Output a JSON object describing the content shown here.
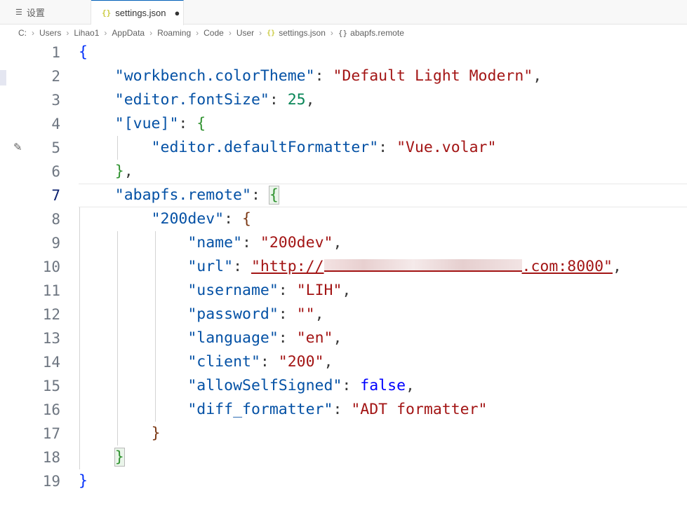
{
  "tabs": [
    {
      "label": "设置",
      "icon": "settings-icon"
    },
    {
      "label": "settings.json",
      "icon": "json-file-icon",
      "dirty_marker": "●"
    }
  ],
  "breadcrumb": {
    "items": [
      "C:",
      "Users",
      "Lihao1",
      "AppData",
      "Roaming",
      "Code",
      "User",
      "settings.json",
      "abapfs.remote"
    ],
    "json_icon": "{}",
    "symbol_icon": "{}"
  },
  "editor": {
    "current_line": 7,
    "line_numbers": [
      "1",
      "2",
      "3",
      "4",
      "5",
      "6",
      "7",
      "8",
      "9",
      "10",
      "11",
      "12",
      "13",
      "14",
      "15",
      "16",
      "17",
      "18",
      "19"
    ],
    "tokens": {
      "l1_open": "{",
      "l2_key": "\"workbench.colorTheme\"",
      "l2_val": "\"Default Light Modern\"",
      "l3_key": "\"editor.fontSize\"",
      "l3_val": "25",
      "l4_key": "\"[vue]\"",
      "l4_open": "{",
      "l5_key": "\"editor.defaultFormatter\"",
      "l5_val": "\"Vue.volar\"",
      "l6_close": "}",
      "l7_key": "\"abapfs.remote\"",
      "l7_open": "{",
      "l8_key": "\"200dev\"",
      "l8_open": "{",
      "l9_key": "\"name\"",
      "l9_val": "\"200dev\"",
      "l10_key": "\"url\"",
      "l10_val_start": "\"http://",
      "l10_val_end": ".com:8000\"",
      "l11_key": "\"username\"",
      "l11_val": "\"LIH\"",
      "l12_key": "\"password\"",
      "l12_val": "\"\"",
      "l13_key": "\"language\"",
      "l13_val": "\"en\"",
      "l14_key": "\"client\"",
      "l14_val": "\"200\"",
      "l15_key": "\"allowSelfSigned\"",
      "l15_val": "false",
      "l16_key": "\"diff_formatter\"",
      "l16_val": "\"ADT formatter\"",
      "l17_close": "}",
      "l18_close": "}",
      "l19_close": "}"
    }
  },
  "colors": {
    "key": "#0451a5",
    "string": "#a31515",
    "number": "#098658",
    "keyword": "#0000ff",
    "accent": "#005fb8"
  }
}
